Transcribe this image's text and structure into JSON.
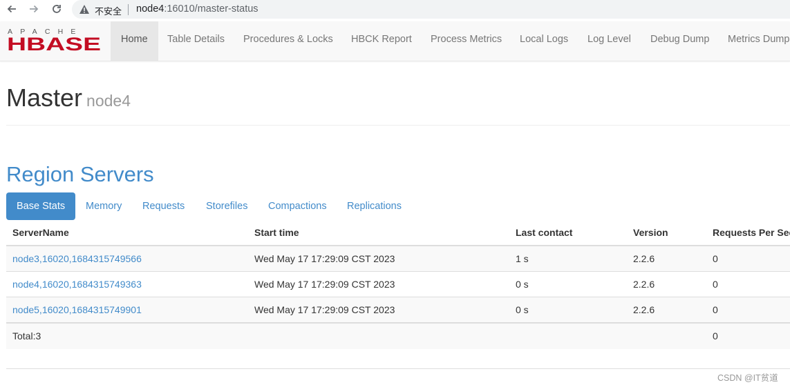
{
  "browser": {
    "insecure_label": "不安全",
    "url_host": "node4",
    "url_rest": ":16010/master-status"
  },
  "navbar": {
    "logo_top": "APACHE",
    "logo_bottom": "HBASE",
    "items": [
      {
        "label": "Home",
        "active": true
      },
      {
        "label": "Table Details"
      },
      {
        "label": "Procedures & Locks"
      },
      {
        "label": "HBCK Report"
      },
      {
        "label": "Process Metrics"
      },
      {
        "label": "Local Logs"
      },
      {
        "label": "Log Level"
      },
      {
        "label": "Debug Dump"
      },
      {
        "label": "Metrics Dump"
      }
    ]
  },
  "page": {
    "title": "Master",
    "subtitle": "node4",
    "section_title": "Region Servers"
  },
  "tabs": [
    {
      "label": "Base Stats",
      "active": true
    },
    {
      "label": "Memory"
    },
    {
      "label": "Requests"
    },
    {
      "label": "Storefiles"
    },
    {
      "label": "Compactions"
    },
    {
      "label": "Replications"
    }
  ],
  "table": {
    "headers": [
      "ServerName",
      "Start time",
      "Last contact",
      "Version",
      "Requests Per Second"
    ],
    "rows": [
      [
        "node3,16020,1684315749566",
        "Wed May 17 17:29:09 CST 2023",
        "1 s",
        "2.2.6",
        "0"
      ],
      [
        "node4,16020,1684315749363",
        "Wed May 17 17:29:09 CST 2023",
        "0 s",
        "2.2.6",
        "0"
      ],
      [
        "node5,16020,1684315749901",
        "Wed May 17 17:29:09 CST 2023",
        "0 s",
        "2.2.6",
        "0"
      ]
    ],
    "total": [
      "Total:3",
      "",
      "",
      "",
      "0"
    ]
  },
  "watermark": "CSDN @IT贫道",
  "colors": {
    "link": "#428bca",
    "logo_red": "#c30d23",
    "nav_bg": "#f8f8f8"
  }
}
